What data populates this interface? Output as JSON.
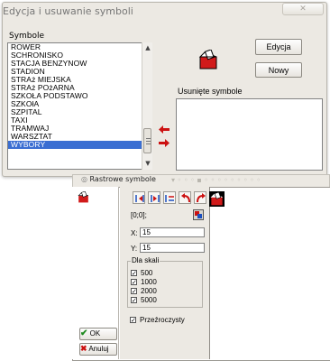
{
  "dialog": {
    "title": "Edycja i usuwanie symboli",
    "symbols_label": "Symbole",
    "symbols": [
      "ROWER",
      "SCHRONISKO",
      "STACJA BENZYNOW",
      "STADION",
      "STRAż MIEJSKA",
      "STRAż POżARNA",
      "SZKOŁA PODSTAWO",
      "SZKOłA",
      "SZPITAL",
      "TAXI",
      "TRAMWAJ",
      "WARSZTAT",
      "WYBORY"
    ],
    "selected_symbol": "WYBORY",
    "edit_button": "Edycja",
    "new_button": "Nowy",
    "removed_label": "Usunięte symbole"
  },
  "strip": {
    "tab_label": "Rastrowe symbole"
  },
  "editor": {
    "coords": "[0;0];",
    "x_label": "X:",
    "x_value": "15",
    "y_label": "Y:",
    "y_value": "15",
    "scale_group_label": "Dla skali",
    "scales": [
      {
        "label": "500",
        "checked": true
      },
      {
        "label": "1000",
        "checked": true
      },
      {
        "label": "2000",
        "checked": true
      },
      {
        "label": "5000",
        "checked": true
      }
    ],
    "transparent_label": "Przeźroczysty",
    "transparent_checked": true,
    "ok_button": "OK",
    "cancel_button": "Anuluj"
  },
  "colors": {
    "selection": "#3a6ed2",
    "icon_red": "#d11a1a",
    "arrow_red": "#cc1111"
  },
  "icons": [
    "ballot-box-icon",
    "arrow-left-icon",
    "arrow-right-icon",
    "close-icon",
    "ok-check-icon",
    "cancel-x-icon"
  ]
}
